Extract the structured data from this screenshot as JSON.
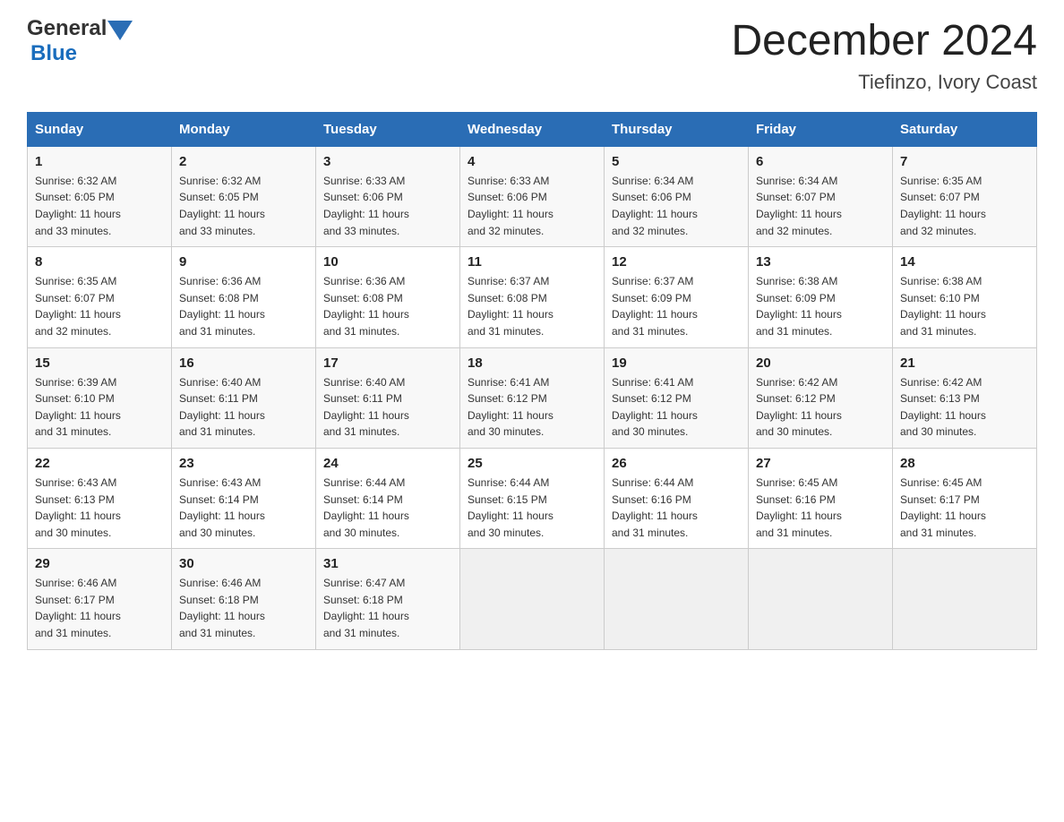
{
  "header": {
    "logo_general": "General",
    "logo_blue": "Blue",
    "month_title": "December 2024",
    "location": "Tiefinzo, Ivory Coast"
  },
  "weekdays": [
    "Sunday",
    "Monday",
    "Tuesday",
    "Wednesday",
    "Thursday",
    "Friday",
    "Saturday"
  ],
  "weeks": [
    [
      {
        "day": "1",
        "sunrise": "6:32 AM",
        "sunset": "6:05 PM",
        "daylight": "11 hours and 33 minutes."
      },
      {
        "day": "2",
        "sunrise": "6:32 AM",
        "sunset": "6:05 PM",
        "daylight": "11 hours and 33 minutes."
      },
      {
        "day": "3",
        "sunrise": "6:33 AM",
        "sunset": "6:06 PM",
        "daylight": "11 hours and 33 minutes."
      },
      {
        "day": "4",
        "sunrise": "6:33 AM",
        "sunset": "6:06 PM",
        "daylight": "11 hours and 32 minutes."
      },
      {
        "day": "5",
        "sunrise": "6:34 AM",
        "sunset": "6:06 PM",
        "daylight": "11 hours and 32 minutes."
      },
      {
        "day": "6",
        "sunrise": "6:34 AM",
        "sunset": "6:07 PM",
        "daylight": "11 hours and 32 minutes."
      },
      {
        "day": "7",
        "sunrise": "6:35 AM",
        "sunset": "6:07 PM",
        "daylight": "11 hours and 32 minutes."
      }
    ],
    [
      {
        "day": "8",
        "sunrise": "6:35 AM",
        "sunset": "6:07 PM",
        "daylight": "11 hours and 32 minutes."
      },
      {
        "day": "9",
        "sunrise": "6:36 AM",
        "sunset": "6:08 PM",
        "daylight": "11 hours and 31 minutes."
      },
      {
        "day": "10",
        "sunrise": "6:36 AM",
        "sunset": "6:08 PM",
        "daylight": "11 hours and 31 minutes."
      },
      {
        "day": "11",
        "sunrise": "6:37 AM",
        "sunset": "6:08 PM",
        "daylight": "11 hours and 31 minutes."
      },
      {
        "day": "12",
        "sunrise": "6:37 AM",
        "sunset": "6:09 PM",
        "daylight": "11 hours and 31 minutes."
      },
      {
        "day": "13",
        "sunrise": "6:38 AM",
        "sunset": "6:09 PM",
        "daylight": "11 hours and 31 minutes."
      },
      {
        "day": "14",
        "sunrise": "6:38 AM",
        "sunset": "6:10 PM",
        "daylight": "11 hours and 31 minutes."
      }
    ],
    [
      {
        "day": "15",
        "sunrise": "6:39 AM",
        "sunset": "6:10 PM",
        "daylight": "11 hours and 31 minutes."
      },
      {
        "day": "16",
        "sunrise": "6:40 AM",
        "sunset": "6:11 PM",
        "daylight": "11 hours and 31 minutes."
      },
      {
        "day": "17",
        "sunrise": "6:40 AM",
        "sunset": "6:11 PM",
        "daylight": "11 hours and 31 minutes."
      },
      {
        "day": "18",
        "sunrise": "6:41 AM",
        "sunset": "6:12 PM",
        "daylight": "11 hours and 30 minutes."
      },
      {
        "day": "19",
        "sunrise": "6:41 AM",
        "sunset": "6:12 PM",
        "daylight": "11 hours and 30 minutes."
      },
      {
        "day": "20",
        "sunrise": "6:42 AM",
        "sunset": "6:12 PM",
        "daylight": "11 hours and 30 minutes."
      },
      {
        "day": "21",
        "sunrise": "6:42 AM",
        "sunset": "6:13 PM",
        "daylight": "11 hours and 30 minutes."
      }
    ],
    [
      {
        "day": "22",
        "sunrise": "6:43 AM",
        "sunset": "6:13 PM",
        "daylight": "11 hours and 30 minutes."
      },
      {
        "day": "23",
        "sunrise": "6:43 AM",
        "sunset": "6:14 PM",
        "daylight": "11 hours and 30 minutes."
      },
      {
        "day": "24",
        "sunrise": "6:44 AM",
        "sunset": "6:14 PM",
        "daylight": "11 hours and 30 minutes."
      },
      {
        "day": "25",
        "sunrise": "6:44 AM",
        "sunset": "6:15 PM",
        "daylight": "11 hours and 30 minutes."
      },
      {
        "day": "26",
        "sunrise": "6:44 AM",
        "sunset": "6:16 PM",
        "daylight": "11 hours and 31 minutes."
      },
      {
        "day": "27",
        "sunrise": "6:45 AM",
        "sunset": "6:16 PM",
        "daylight": "11 hours and 31 minutes."
      },
      {
        "day": "28",
        "sunrise": "6:45 AM",
        "sunset": "6:17 PM",
        "daylight": "11 hours and 31 minutes."
      }
    ],
    [
      {
        "day": "29",
        "sunrise": "6:46 AM",
        "sunset": "6:17 PM",
        "daylight": "11 hours and 31 minutes."
      },
      {
        "day": "30",
        "sunrise": "6:46 AM",
        "sunset": "6:18 PM",
        "daylight": "11 hours and 31 minutes."
      },
      {
        "day": "31",
        "sunrise": "6:47 AM",
        "sunset": "6:18 PM",
        "daylight": "11 hours and 31 minutes."
      },
      null,
      null,
      null,
      null
    ]
  ],
  "labels": {
    "sunrise": "Sunrise:",
    "sunset": "Sunset:",
    "daylight": "Daylight:"
  }
}
